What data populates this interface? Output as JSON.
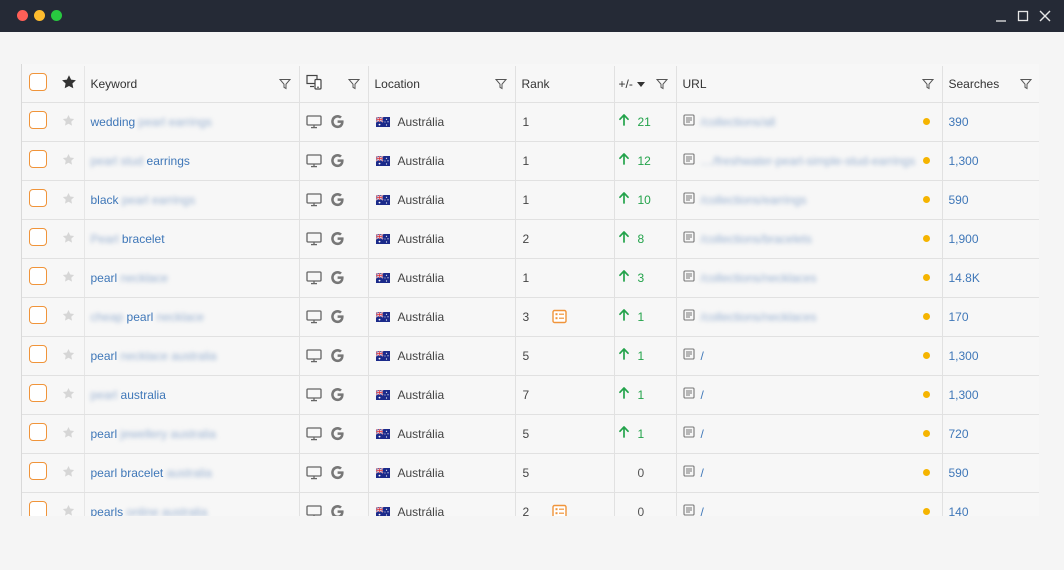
{
  "window": {
    "controls": [
      "minimize-icon",
      "maximize-icon",
      "close-icon"
    ]
  },
  "colors": {
    "accent": "#3f77b8",
    "up": "#23a34b",
    "checkbox": "#f0943a",
    "dot": "#f5b400",
    "titlebar": "#252a36"
  },
  "headers": {
    "keyword": "Keyword",
    "location": "Location",
    "rank": "Rank",
    "change": "+/-",
    "url": "URL",
    "searches": "Searches"
  },
  "rows": [
    {
      "kw_a": "wedding",
      "kw_b": "pearl earrings",
      "kw_order": "ab",
      "location": "Austrália",
      "rank": "1",
      "sticky": false,
      "change": "21",
      "dir": "up",
      "url": "/collections/all",
      "url_blur": true,
      "searches": "390"
    },
    {
      "kw_a": "earrings",
      "kw_b": "pearl stud",
      "kw_order": "ba",
      "location": "Austrália",
      "rank": "1",
      "sticky": false,
      "change": "12",
      "dir": "up",
      "url": "…/freshwater-pearl-simple-stud-earrings",
      "url_blur": true,
      "searches": "1,300"
    },
    {
      "kw_a": "black",
      "kw_b": "pearl earrings",
      "kw_order": "ab",
      "location": "Austrália",
      "rank": "1",
      "sticky": false,
      "change": "10",
      "dir": "up",
      "url": "/collections/earrings",
      "url_blur": true,
      "searches": "590"
    },
    {
      "kw_a": "bracelet",
      "kw_b": "Pearl",
      "kw_order": "ba",
      "location": "Austrália",
      "rank": "2",
      "sticky": false,
      "change": "8",
      "dir": "up",
      "url": "/collections/bracelets",
      "url_blur": true,
      "searches": "1,900"
    },
    {
      "kw_a": "pearl",
      "kw_b": "necklace",
      "kw_order": "ab",
      "location": "Austrália",
      "rank": "1",
      "sticky": false,
      "change": "3",
      "dir": "up",
      "url": "/collections/necklaces",
      "url_blur": true,
      "searches": "14.8K"
    },
    {
      "kw_a": "pearl",
      "kw_b": "cheap",
      "kw_b2": "necklace",
      "kw_order": "bab",
      "location": "Austrália",
      "rank": "3",
      "sticky": true,
      "change": "1",
      "dir": "up",
      "url": "/collections/necklaces",
      "url_blur": true,
      "searches": "170"
    },
    {
      "kw_a": "pearl",
      "kw_b": "necklace australia",
      "kw_order": "ab",
      "location": "Austrália",
      "rank": "5",
      "sticky": false,
      "change": "1",
      "dir": "up",
      "url": "/",
      "url_blur": false,
      "searches": "1,300"
    },
    {
      "kw_a": "australia",
      "kw_b": "pearl",
      "kw_order": "ba",
      "location": "Austrália",
      "rank": "7",
      "sticky": false,
      "change": "1",
      "dir": "up",
      "url": "/",
      "url_blur": false,
      "searches": "1,300"
    },
    {
      "kw_a": "pearl",
      "kw_b": "jewellery australia",
      "kw_order": "ab",
      "location": "Austrália",
      "rank": "5",
      "sticky": false,
      "change": "1",
      "dir": "up",
      "url": "/",
      "url_blur": false,
      "searches": "720"
    },
    {
      "kw_a": "pearl bracelet",
      "kw_b": "australia",
      "kw_order": "ab",
      "location": "Austrália",
      "rank": "5",
      "sticky": false,
      "change": "0",
      "dir": "none",
      "url": "/",
      "url_blur": false,
      "searches": "590"
    },
    {
      "kw_a": "pearls",
      "kw_b": "online australia",
      "kw_order": "ab",
      "location": "Austrália",
      "rank": "2",
      "sticky": true,
      "change": "0",
      "dir": "none",
      "url": "/",
      "url_blur": false,
      "searches": "140"
    }
  ]
}
